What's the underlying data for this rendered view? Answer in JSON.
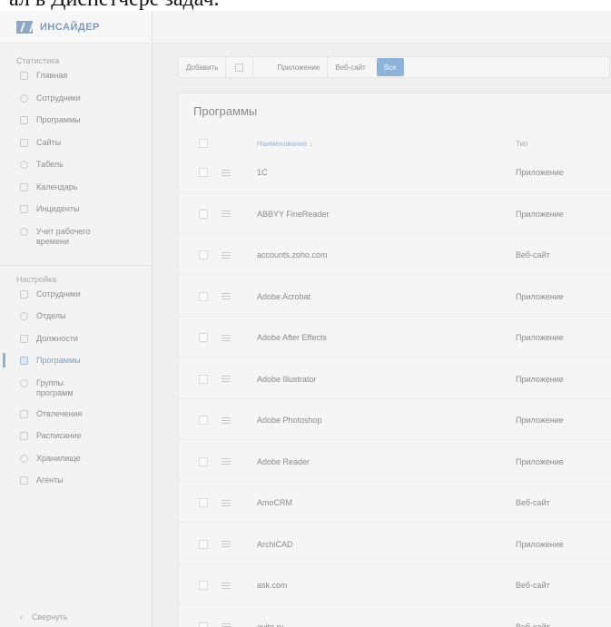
{
  "top_text": "ал в Диспетчере задач.",
  "logo": {
    "text": "ИНСАЙДЕР"
  },
  "sidebar": {
    "stats_title": "Статистика",
    "stats_items": [
      {
        "label": "Главная",
        "icon": "home-icon"
      },
      {
        "label": "Сотрудники",
        "icon": "user-icon"
      },
      {
        "label": "Программы",
        "icon": "apps-icon"
      },
      {
        "label": "Сайты",
        "icon": "globe-icon"
      },
      {
        "label": "Табель",
        "icon": "table-icon"
      },
      {
        "label": "Календарь",
        "icon": "calendar-icon"
      },
      {
        "label": "Инциденты",
        "icon": "alert-icon"
      },
      {
        "label": "Учет рабочего времени",
        "icon": "clock-icon"
      }
    ],
    "settings_title": "Настройка",
    "settings_items": [
      {
        "label": "Сотрудники",
        "icon": "user-icon"
      },
      {
        "label": "Отделы",
        "icon": "departments-icon"
      },
      {
        "label": "Должности",
        "icon": "position-icon"
      },
      {
        "label": "Программы",
        "icon": "apps-icon",
        "active": true
      },
      {
        "label": "Группы программ",
        "icon": "group-icon"
      },
      {
        "label": "Отвлечения",
        "icon": "distraction-icon"
      },
      {
        "label": "Расписание",
        "icon": "schedule-icon"
      },
      {
        "label": "Хранилище",
        "icon": "storage-icon"
      },
      {
        "label": "Агенты",
        "icon": "agent-icon"
      }
    ],
    "collapse_label": "Свернуть"
  },
  "toolbar": {
    "add_label": "Добавить",
    "filter_app_label": "Приложение",
    "filter_web_label": "Веб-сайт",
    "filter_all_label": "Все"
  },
  "programs": {
    "title": "Программы",
    "col_name": "Наименование ↓",
    "col_type": "Тип",
    "rows": [
      {
        "name": "1С",
        "type": "Приложение"
      },
      {
        "name": "ABBYY FineReader",
        "type": "Приложение"
      },
      {
        "name": "accounts.zoho.com",
        "type": "Веб-сайт"
      },
      {
        "name": "Adobe Acrobat",
        "type": "Приложение"
      },
      {
        "name": "Adobe After Effects",
        "type": "Приложение"
      },
      {
        "name": "Adobe Illustrator",
        "type": "Приложение"
      },
      {
        "name": "Adobe Photoshop",
        "type": "Приложение"
      },
      {
        "name": "Adobe Reader",
        "type": "Приложение"
      },
      {
        "name": "AmoCRM",
        "type": "Веб-сайт"
      },
      {
        "name": "ArchiCAD",
        "type": "Приложение"
      },
      {
        "name": "ask.com",
        "type": "Веб-сайт"
      },
      {
        "name": "avito.ru",
        "type": "Веб-сайт"
      }
    ]
  },
  "colors": {
    "accent": "#8db3da",
    "text_muted": "#8a8a8a",
    "background": "#efefef"
  }
}
